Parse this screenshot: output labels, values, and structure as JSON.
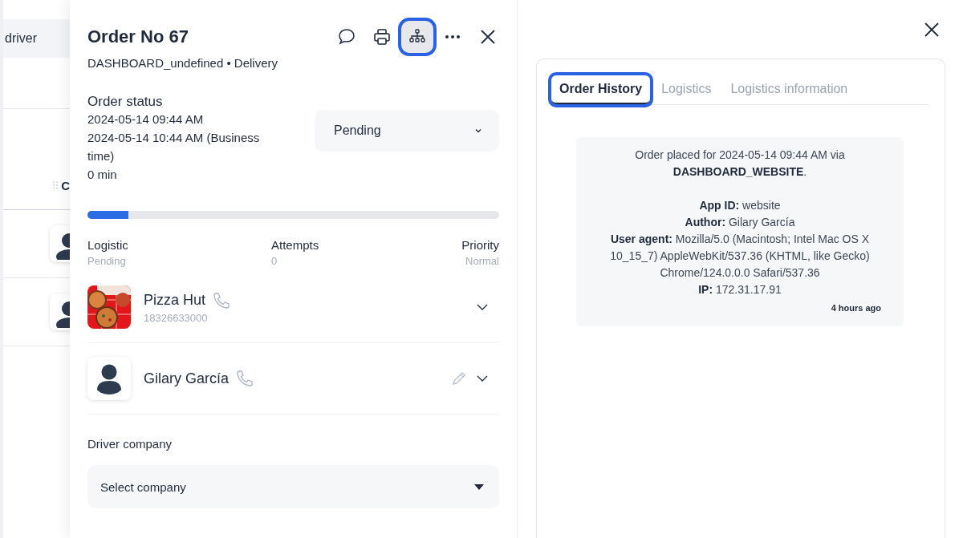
{
  "background": {
    "header_fragment": "driver",
    "column_fragment": "C"
  },
  "order": {
    "title": "Order No 67",
    "subtitle": "DASHBOARD_undefined • Delivery",
    "toolbar": [
      {
        "kind": "chat",
        "highlighted": false
      },
      {
        "kind": "print",
        "highlighted": false
      },
      {
        "kind": "hierarchy",
        "highlighted": true
      },
      {
        "kind": "more",
        "highlighted": false
      },
      {
        "kind": "close",
        "highlighted": false
      }
    ],
    "status": {
      "heading": "Order status",
      "lines": [
        "2024-05-14 09:44 AM",
        "2024-05-14 10:44 AM (Business time)",
        "0 min"
      ],
      "select": "Pending",
      "level": 0.1
    },
    "stats": [
      {
        "label": "Logistic",
        "value": "Pending"
      },
      {
        "label": "Attempts",
        "value": "0"
      },
      {
        "label": "Priority",
        "value": "Normal"
      }
    ],
    "contacts": [
      {
        "kind": "store",
        "name": "Pizza Hut",
        "phone": "18326633000",
        "editable": false
      },
      {
        "kind": "person",
        "name": "Gilary García",
        "editable": true
      }
    ],
    "driver_company": {
      "label": "Driver company",
      "placeholder": "Select company"
    }
  },
  "history": {
    "tabs": [
      {
        "label": "Order History",
        "selected": true,
        "highlighted": true
      },
      {
        "label": "Logistics",
        "selected": false,
        "highlighted": false
      },
      {
        "label": "Logistics information",
        "selected": false,
        "highlighted": false
      }
    ],
    "entry": {
      "summary": "Order placed for 2024-05-14 09:44 AM via **DASHBOARD_WEBSITE**.",
      "details": [
        "**App ID:** website",
        "**Author:** Gilary García",
        "**User agent:** Mozilla/5.0 (Macintosh; Intel Mac OS X 10_15_7) AppleWebKit/537.36 (KHTML, like Gecko) Chrome/124.0.0.0 Safari/537.36",
        "**IP:** 172.31.17.91"
      ],
      "time": "4 hours ago"
    }
  }
}
